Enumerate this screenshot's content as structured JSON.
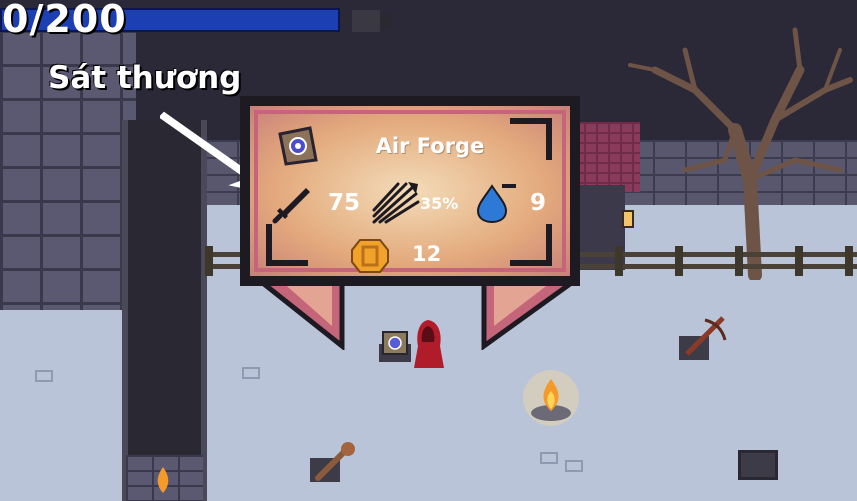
{
  "hud": {
    "health_text": "0/200",
    "health_fraction": 1.0
  },
  "annotation": {
    "label": "Sát thương"
  },
  "tooltip": {
    "title": "Air Forge",
    "stats": {
      "damage": "75",
      "crit": "35%",
      "mana": "9",
      "gold": "12"
    }
  },
  "colors": {
    "health_bar": "#1d3fb4",
    "tooltip_border": "#c4657a",
    "tooltip_fill": "#e7b486",
    "ground": "#b9c4d8"
  },
  "icons": {
    "item": "magic-tome-icon",
    "damage": "sword-icon",
    "crit": "arrow-burst-icon",
    "mana": "mana-drop-icon",
    "gold": "gold-coin-icon"
  }
}
